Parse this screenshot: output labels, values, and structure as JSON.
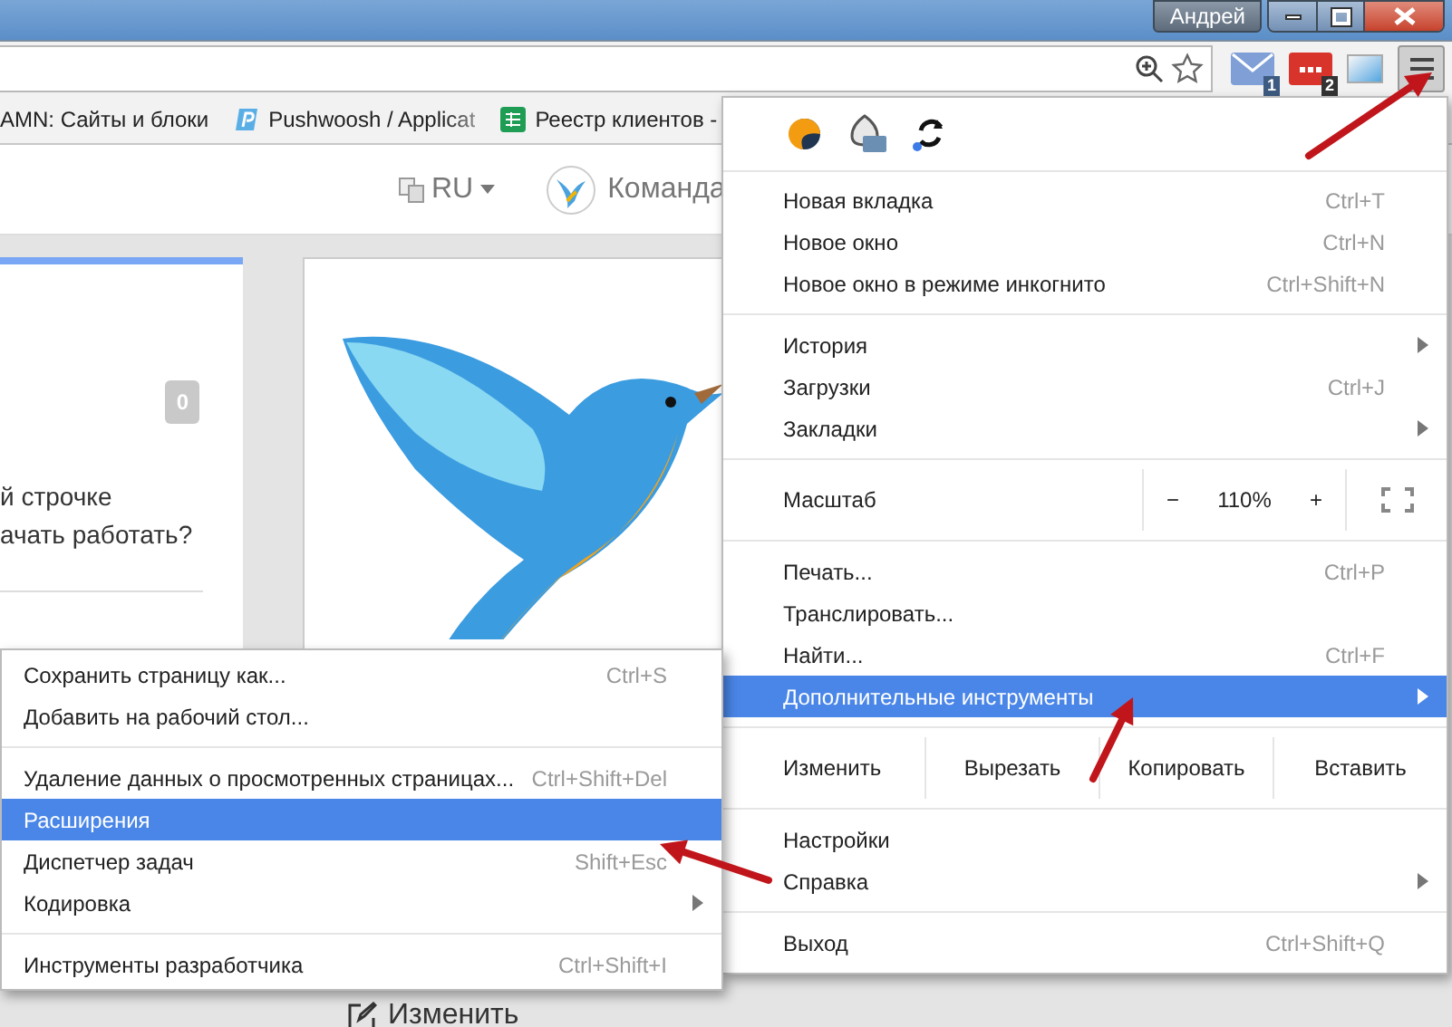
{
  "window": {
    "user": "Андрей"
  },
  "toolbar": {
    "extension_badges": [
      "1",
      "2"
    ]
  },
  "bookmarks": [
    {
      "label": "AMN: Сайты и блоки",
      "faded": false
    },
    {
      "label": "Pushwoosh / Applicat",
      "faded": true
    },
    {
      "label": "Реестр клиентов -",
      "faded": false
    }
  ],
  "page": {
    "language": "RU",
    "brand": "Команда",
    "card": {
      "count": "0",
      "lines": [
        "й строчке",
        "ачать работать?"
      ]
    },
    "edit_link": "Изменить"
  },
  "menu": {
    "sections": [
      [
        {
          "kind": "item",
          "label": "Новая вкладка",
          "shortcut": "Ctrl+T",
          "submenu": false,
          "selected": false
        },
        {
          "kind": "item",
          "label": "Новое окно",
          "shortcut": "Ctrl+N",
          "submenu": false,
          "selected": false
        },
        {
          "kind": "item",
          "label": "Новое окно в режиме инкогнито",
          "shortcut": "Ctrl+Shift+N",
          "submenu": false,
          "selected": false
        }
      ],
      [
        {
          "kind": "item",
          "label": "История",
          "submenu": true,
          "selected": false
        },
        {
          "kind": "item",
          "label": "Загрузки",
          "shortcut": "Ctrl+J",
          "submenu": false,
          "selected": false
        },
        {
          "kind": "item",
          "label": "Закладки",
          "submenu": true,
          "selected": false
        }
      ],
      [
        {
          "kind": "zoom",
          "label": "Масштаб",
          "minus": "−",
          "value": "110%",
          "plus": "+"
        }
      ],
      [
        {
          "kind": "item",
          "label": "Печать...",
          "shortcut": "Ctrl+P",
          "submenu": false,
          "selected": false
        },
        {
          "kind": "item",
          "label": "Транслировать...",
          "submenu": false,
          "selected": false
        },
        {
          "kind": "item",
          "label": "Найти...",
          "shortcut": "Ctrl+F",
          "submenu": false,
          "selected": false
        },
        {
          "kind": "item",
          "label": "Дополнительные инструменты",
          "submenu": true,
          "selected": true
        }
      ],
      [
        {
          "kind": "edit",
          "label": "Изменить",
          "actions": [
            "Вырезать",
            "Копировать",
            "Вставить"
          ]
        }
      ],
      [
        {
          "kind": "item",
          "label": "Настройки",
          "submenu": false,
          "selected": false
        },
        {
          "kind": "item",
          "label": "Справка",
          "submenu": true,
          "selected": false
        }
      ],
      [
        {
          "kind": "item",
          "label": "Выход",
          "shortcut": "Ctrl+Shift+Q",
          "submenu": false,
          "selected": false
        }
      ]
    ]
  },
  "submenu": {
    "sections": [
      [
        {
          "kind": "item",
          "label": "Сохранить страницу как...",
          "shortcut": "Ctrl+S",
          "submenu": false,
          "selected": false
        },
        {
          "kind": "item",
          "label": "Добавить на рабочий стол...",
          "submenu": false,
          "selected": false
        }
      ],
      [
        {
          "kind": "item",
          "label": "Удаление данных о просмотренных страницах...",
          "shortcut": "Ctrl+Shift+Del",
          "submenu": false,
          "selected": false
        },
        {
          "kind": "item",
          "label": "Расширения",
          "submenu": false,
          "selected": true
        },
        {
          "kind": "item",
          "label": "Диспетчер задач",
          "shortcut": "Shift+Esc",
          "submenu": false,
          "selected": false
        },
        {
          "kind": "item",
          "label": "Кодировка",
          "submenu": true,
          "selected": false
        }
      ],
      [
        {
          "kind": "item",
          "label": "Инструменты разработчика",
          "shortcut": "Ctrl+Shift+I",
          "submenu": false,
          "selected": false
        }
      ]
    ]
  }
}
